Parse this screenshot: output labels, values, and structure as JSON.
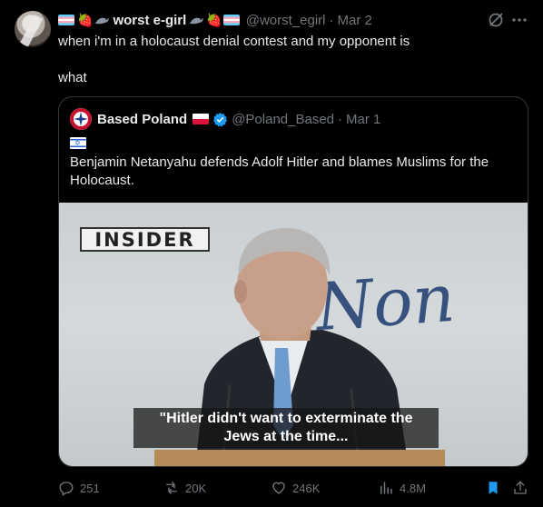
{
  "post": {
    "display_name": "worst e-girl",
    "handle": "@worst_egirl",
    "separator": "·",
    "date": "Mar 2",
    "text_line1": "when i'm in a holocaust denial contest and my opponent is",
    "text_line2": "what",
    "name_emojis": [
      "trans-flag",
      "strawberry",
      "seal"
    ],
    "name_emojis_after": [
      "seal",
      "strawberry",
      "trans-flag"
    ]
  },
  "quote": {
    "display_name": "Based Poland",
    "handle": "@Poland_Based",
    "separator": "·",
    "date": "Mar 1",
    "flag": "israel-flag",
    "text": "Benjamin Netanyahu defends Adolf Hitler and blames Muslims for the Holocaust.",
    "video": {
      "watermark": "INSIDER",
      "background_text": "Non",
      "caption_line1": "\"Hitler didn't want to exterminate the",
      "caption_line2": "Jews at the time..."
    }
  },
  "actions": {
    "replies": "251",
    "reposts": "20K",
    "likes": "246K",
    "views": "4.8M"
  },
  "colors": {
    "background": "#000000",
    "text": "#e7e9ea",
    "muted": "#71767b",
    "border": "#333639",
    "bookmark_active": "#1d9bf0",
    "verified": "#1d9bf0"
  }
}
